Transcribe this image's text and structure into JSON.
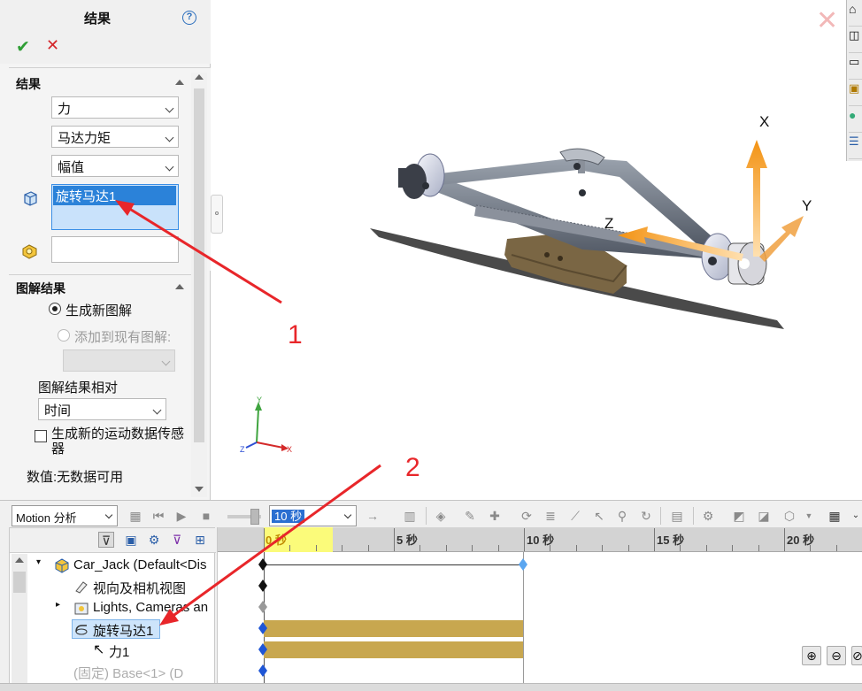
{
  "property_manager": {
    "title": "结果",
    "help": "?",
    "ok_glyph": "✔",
    "cancel_glyph": "✕",
    "results_group": {
      "title": "结果",
      "combo_category": "力",
      "combo_subcategory": "马达力矩",
      "combo_component": "幅值",
      "selected_item": "旋转马达1"
    },
    "graph_group": {
      "title": "图解结果",
      "radio_new": "生成新图解",
      "radio_existing": "添加到现有图解:",
      "relative_label": "图解结果相对",
      "relative_value": "时间",
      "sensor_checkbox": "生成新的运动数据传感器",
      "value_text": "数值:无数据可用"
    }
  },
  "viewport": {
    "axis_x": "X",
    "axis_y": "Y",
    "axis_z": "Z",
    "triad_x": "X",
    "triad_y": "Y",
    "triad_z": "Z"
  },
  "annotations": {
    "label_1": "1",
    "label_2": "2",
    "color": "#e8262a"
  },
  "motion": {
    "study_type": "Motion 分析",
    "time_value": "10 秒",
    "ruler_labels": [
      "0 秒",
      "5 秒",
      "10 秒",
      "15 秒",
      "20 秒"
    ],
    "tree": {
      "root": "Car_Jack  (Default<Dis",
      "views": "视向及相机视图",
      "lights": "Lights, Cameras an",
      "motor": "旋转马达1",
      "force": "力1",
      "partial": "(固定) Base<1> (D"
    },
    "timeline_color": "#c8a74f",
    "playhead_highlight": "#fbfb7a"
  }
}
